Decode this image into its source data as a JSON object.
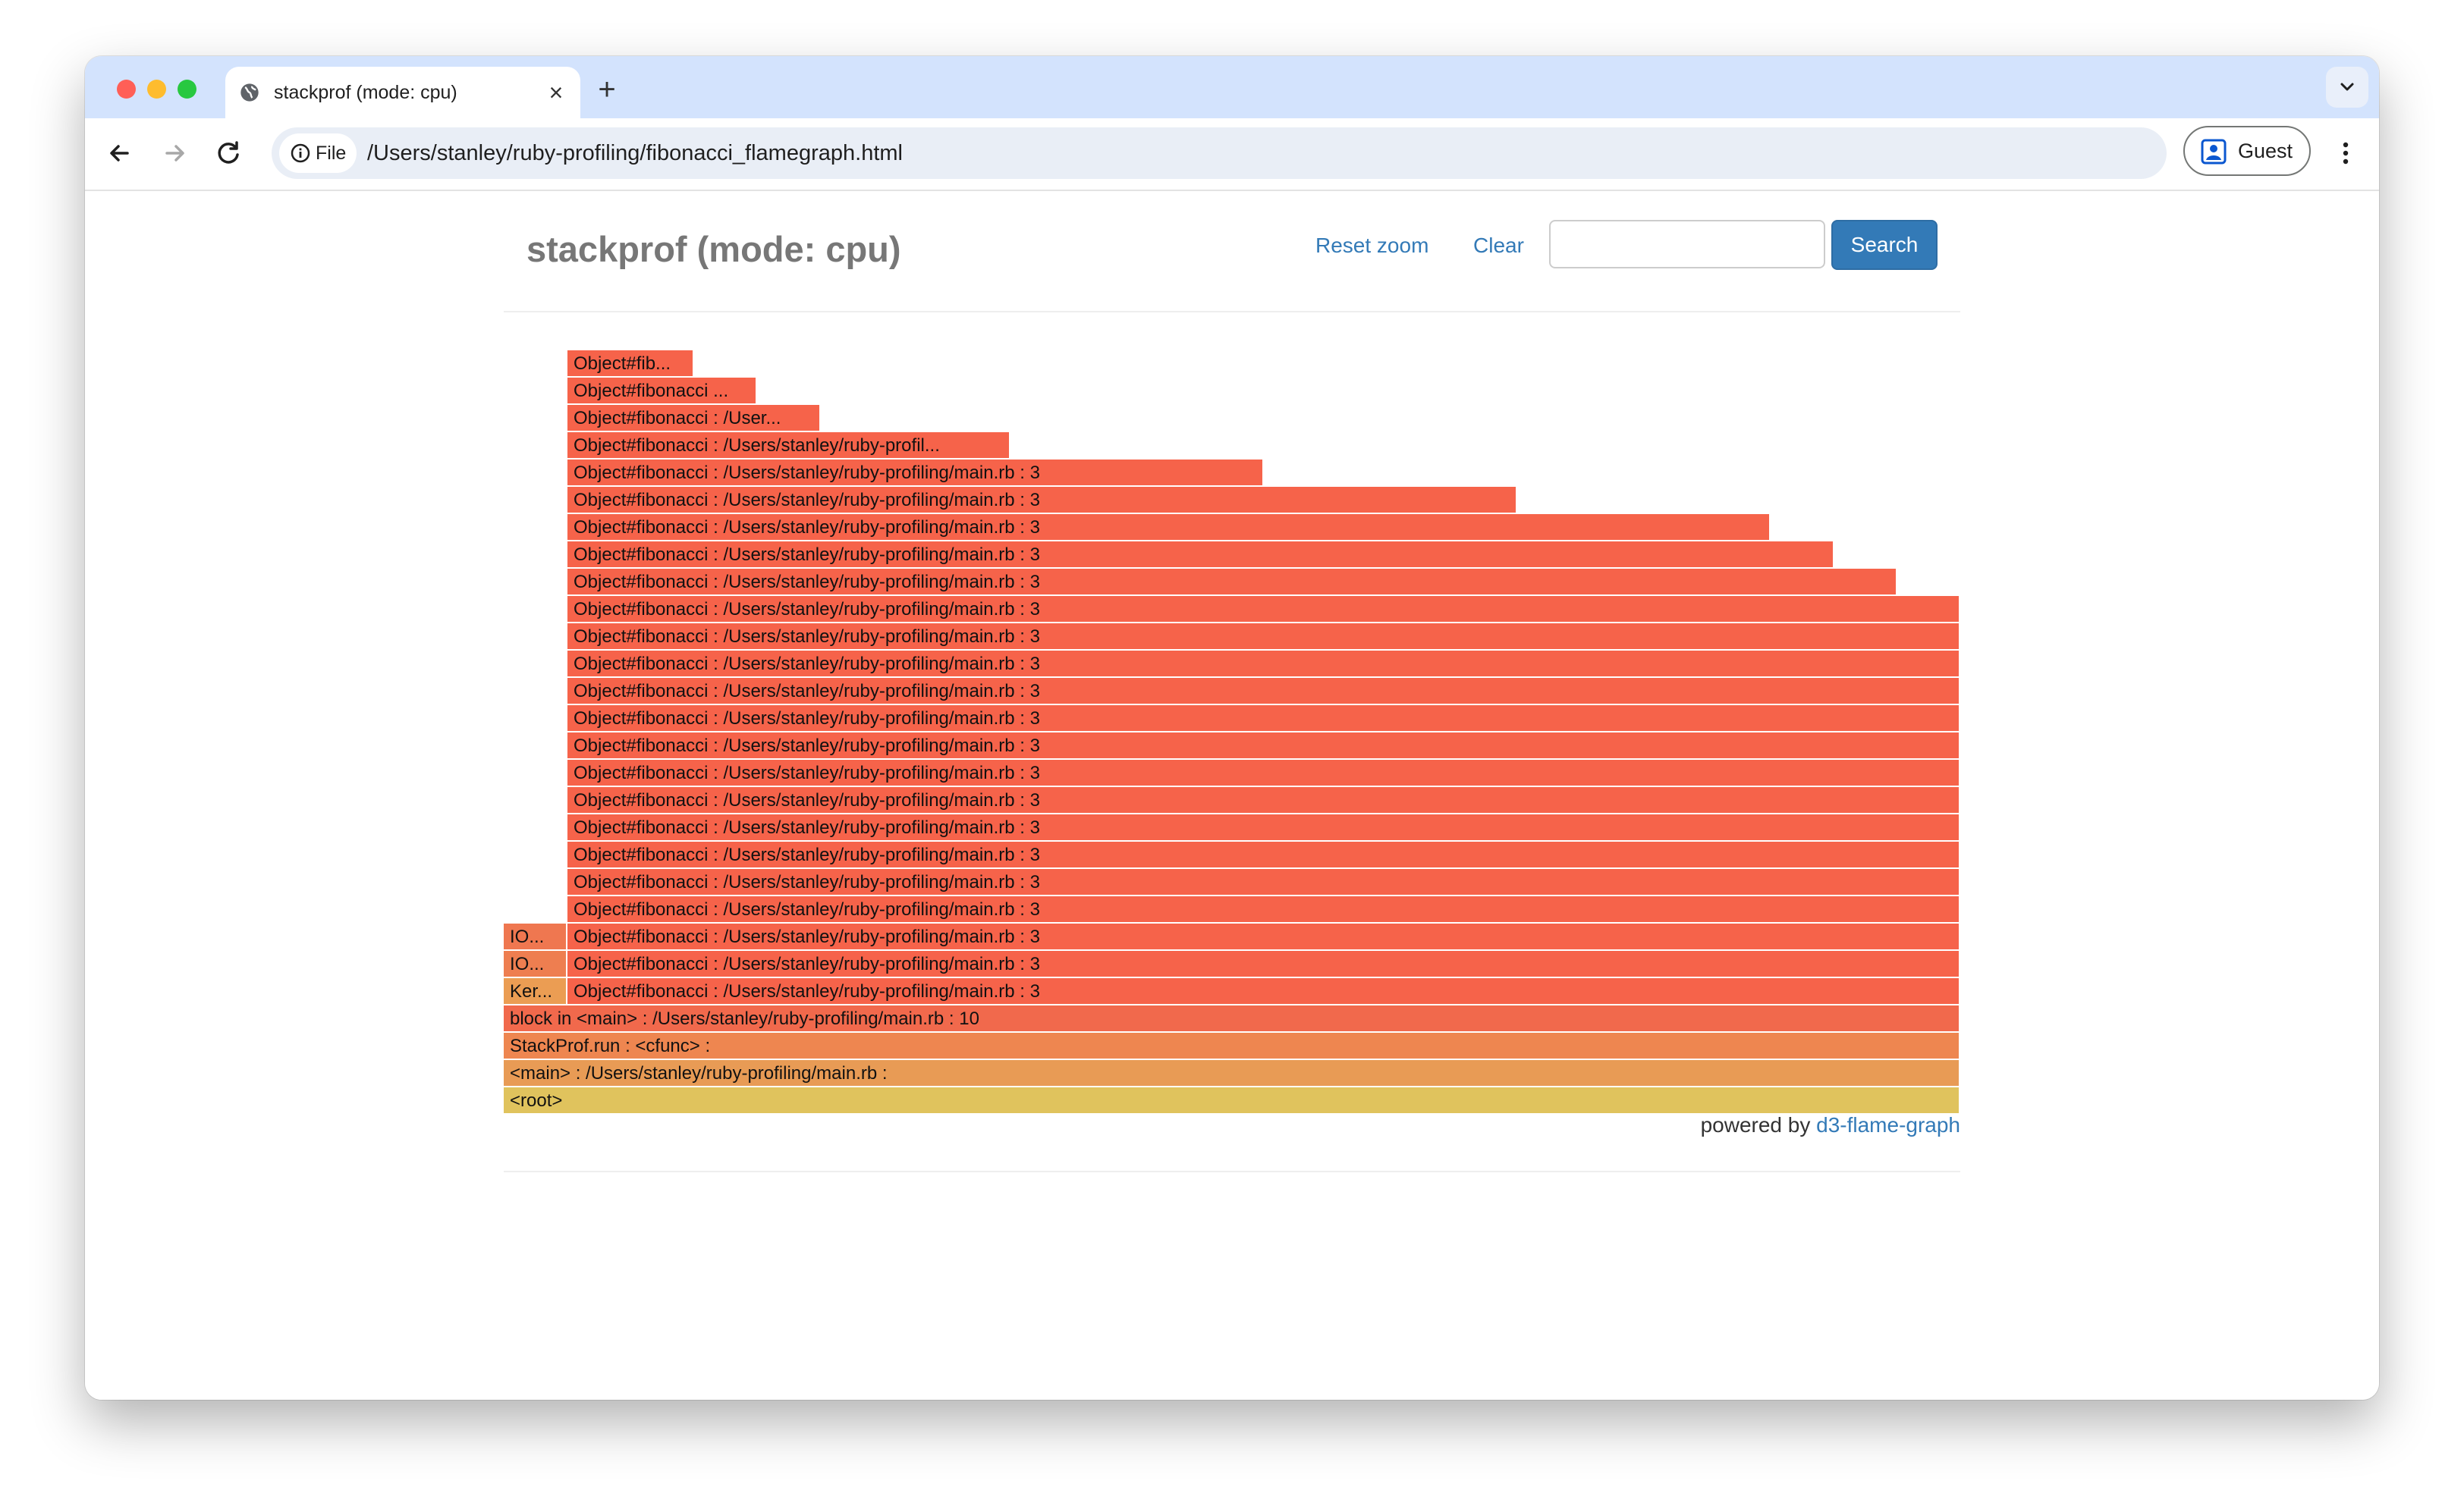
{
  "browser": {
    "tab_title": "stackprof (mode: cpu)",
    "url": "/Users/stanley/ruby-profiling/fibonacci_flamegraph.html",
    "security_chip_label": "File",
    "profile_label": "Guest",
    "colors": {
      "traffic_close": "#ff5f57",
      "traffic_minimize": "#febc2e",
      "traffic_zoom": "#28c840",
      "tabstrip": "#d3e3fd"
    }
  },
  "page": {
    "title": "stackprof (mode: cpu)",
    "reset_zoom_label": "Reset zoom",
    "clear_label": "Clear",
    "search_value": "",
    "search_button_label": "Search",
    "powered_by_text": "powered by",
    "powered_by_link": "d3-flame-graph"
  },
  "flamegraph": {
    "frames": [
      {
        "label": "<root>",
        "depth": 0,
        "start": 0,
        "share": 1,
        "color": "#e0c35d"
      },
      {
        "label": "<main> : /Users/stanley/ruby-profiling/main.rb :",
        "depth": 1,
        "start": 0,
        "share": 1,
        "color": "#e89b55"
      },
      {
        "label": "StackProf.run : <cfunc> :",
        "depth": 2,
        "start": 0,
        "share": 1,
        "color": "#ee8650"
      },
      {
        "label": "block in <main> : /Users/stanley/ruby-profiling/main.rb : 10",
        "depth": 3,
        "start": 0,
        "share": 1,
        "color": "#f1694c"
      },
      {
        "label": "Ker...",
        "depth": 4,
        "start": 0,
        "share": 0.0435,
        "color": "#eb9d53"
      },
      {
        "label": "Object#fibonacci : /Users/stanley/ruby-profiling/main.rb : 3",
        "depth": 4,
        "start": 0.0435,
        "share": 0.9565,
        "color": "#f6634a"
      },
      {
        "label": "IO...",
        "depth": 5,
        "start": 0,
        "share": 0.0435,
        "color": "#ee7e50"
      },
      {
        "label": "Object#fibonacci : /Users/stanley/ruby-profiling/main.rb : 3",
        "depth": 5,
        "start": 0.0435,
        "share": 0.9565,
        "color": "#f6634a"
      },
      {
        "label": "IO...",
        "depth": 6,
        "start": 0,
        "share": 0.0435,
        "color": "#ef7750"
      },
      {
        "label": "Object#fibonacci : /Users/stanley/ruby-profiling/main.rb : 3",
        "depth": 6,
        "start": 0.0435,
        "share": 0.9565,
        "color": "#f6634a"
      },
      {
        "label": "Object#fibonacci : /Users/stanley/ruby-profiling/main.rb : 3",
        "depth": 7,
        "start": 0.0435,
        "share": 0.9565,
        "color": "#f6634a"
      },
      {
        "label": "Object#fibonacci : /Users/stanley/ruby-profiling/main.rb : 3",
        "depth": 8,
        "start": 0.0435,
        "share": 0.9565,
        "color": "#f6634a"
      },
      {
        "label": "Object#fibonacci : /Users/stanley/ruby-profiling/main.rb : 3",
        "depth": 9,
        "start": 0.0435,
        "share": 0.9565,
        "color": "#f6634a"
      },
      {
        "label": "Object#fibonacci : /Users/stanley/ruby-profiling/main.rb : 3",
        "depth": 10,
        "start": 0.0435,
        "share": 0.9565,
        "color": "#f6634a"
      },
      {
        "label": "Object#fibonacci : /Users/stanley/ruby-profiling/main.rb : 3",
        "depth": 11,
        "start": 0.0435,
        "share": 0.9565,
        "color": "#f6634a"
      },
      {
        "label": "Object#fibonacci : /Users/stanley/ruby-profiling/main.rb : 3",
        "depth": 12,
        "start": 0.0435,
        "share": 0.9565,
        "color": "#f6634a"
      },
      {
        "label": "Object#fibonacci : /Users/stanley/ruby-profiling/main.rb : 3",
        "depth": 13,
        "start": 0.0435,
        "share": 0.9565,
        "color": "#f6634a"
      },
      {
        "label": "Object#fibonacci : /Users/stanley/ruby-profiling/main.rb : 3",
        "depth": 14,
        "start": 0.0435,
        "share": 0.9565,
        "color": "#f6634a"
      },
      {
        "label": "Object#fibonacci : /Users/stanley/ruby-profiling/main.rb : 3",
        "depth": 15,
        "start": 0.0435,
        "share": 0.9565,
        "color": "#f6634a"
      },
      {
        "label": "Object#fibonacci : /Users/stanley/ruby-profiling/main.rb : 3",
        "depth": 16,
        "start": 0.0435,
        "share": 0.9565,
        "color": "#f6634a"
      },
      {
        "label": "Object#fibonacci : /Users/stanley/ruby-profiling/main.rb : 3",
        "depth": 17,
        "start": 0.0435,
        "share": 0.9565,
        "color": "#f6634a"
      },
      {
        "label": "Object#fibonacci : /Users/stanley/ruby-profiling/main.rb : 3",
        "depth": 18,
        "start": 0.0435,
        "share": 0.9565,
        "color": "#f6634a"
      },
      {
        "label": "Object#fibonacci : /Users/stanley/ruby-profiling/main.rb : 3",
        "depth": 19,
        "start": 0.0435,
        "share": 0.913,
        "color": "#f6634a"
      },
      {
        "label": "Object#fibonacci : /Users/stanley/ruby-profiling/main.rb : 3",
        "depth": 20,
        "start": 0.0435,
        "share": 0.8696,
        "color": "#f6634a"
      },
      {
        "label": "Object#fibonacci : /Users/stanley/ruby-profiling/main.rb : 3",
        "depth": 21,
        "start": 0.0435,
        "share": 0.8261,
        "color": "#f6634a"
      },
      {
        "label": "Object#fibonacci : /Users/stanley/ruby-profiling/main.rb : 3",
        "depth": 22,
        "start": 0.0435,
        "share": 0.6522,
        "color": "#f6634a"
      },
      {
        "label": "Object#fibonacci : /Users/stanley/ruby-profiling/main.rb : 3",
        "depth": 23,
        "start": 0.0435,
        "share": 0.4783,
        "color": "#f6634a"
      },
      {
        "label": "Object#fibonacci : /Users/stanley/ruby-profil...",
        "depth": 24,
        "start": 0.0435,
        "share": 0.3043,
        "color": "#f6634a"
      },
      {
        "label": "Object#fibonacci : /User...",
        "depth": 25,
        "start": 0.0435,
        "share": 0.1739,
        "color": "#f6634a"
      },
      {
        "label": "Object#fibonacci ...",
        "depth": 26,
        "start": 0.0435,
        "share": 0.1304,
        "color": "#f6634a"
      },
      {
        "label": "Object#fib...",
        "depth": 27,
        "start": 0.0435,
        "share": 0.087,
        "color": "#f6634a"
      }
    ]
  }
}
